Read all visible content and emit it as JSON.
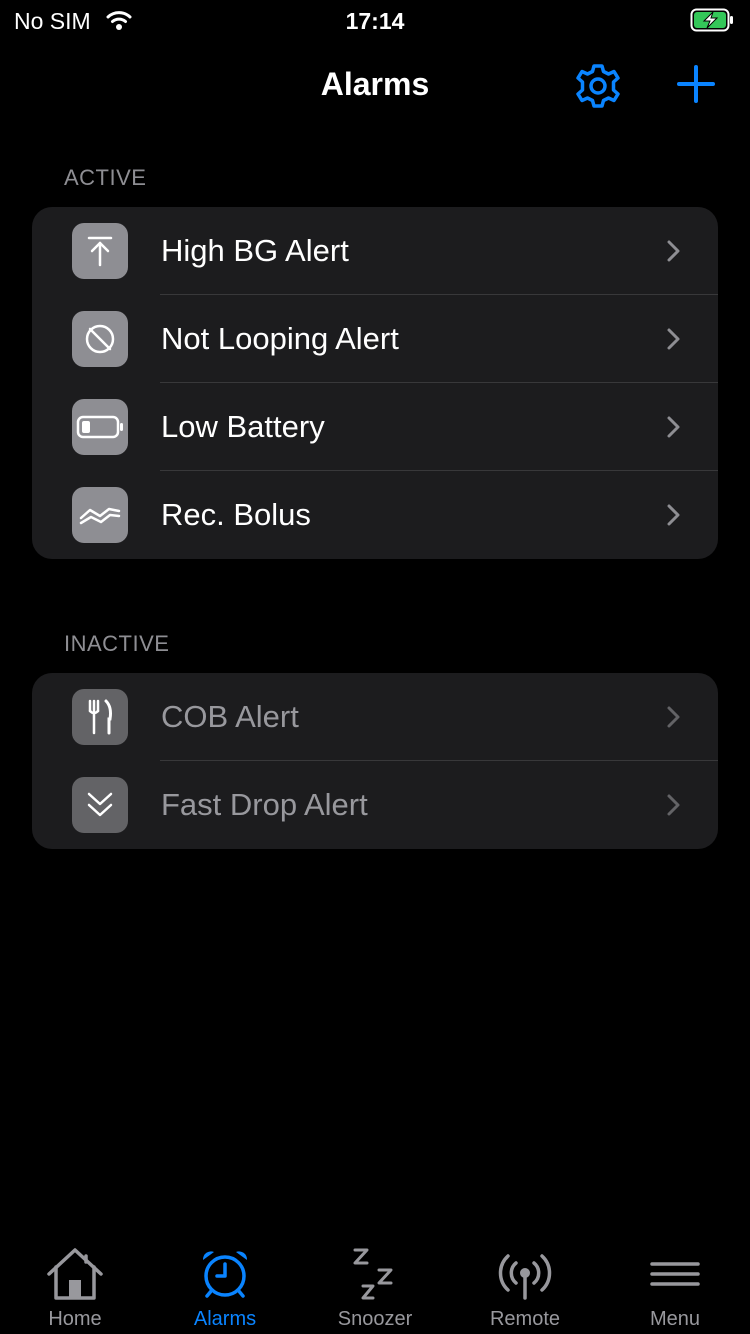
{
  "status_bar": {
    "carrier": "No SIM",
    "time": "17:14"
  },
  "nav": {
    "title": "Alarms",
    "settings_icon": "gear-icon",
    "add_icon": "plus-icon"
  },
  "sections": {
    "active": {
      "header": "ACTIVE",
      "items": [
        {
          "label": "High BG Alert",
          "icon": "arrow-up-to-line-icon"
        },
        {
          "label": "Not Looping Alert",
          "icon": "circle-slash-icon"
        },
        {
          "label": "Low Battery",
          "icon": "battery-low-icon"
        },
        {
          "label": "Rec. Bolus",
          "icon": "waveform-icon"
        }
      ]
    },
    "inactive": {
      "header": "INACTIVE",
      "items": [
        {
          "label": "COB Alert",
          "icon": "fork-knife-icon"
        },
        {
          "label": "Fast Drop Alert",
          "icon": "double-chevron-down-icon"
        }
      ]
    }
  },
  "tabs": [
    {
      "label": "Home",
      "icon": "house-icon",
      "active": false
    },
    {
      "label": "Alarms",
      "icon": "alarm-clock-icon",
      "active": true
    },
    {
      "label": "Snoozer",
      "icon": "zzz-icon",
      "active": false
    },
    {
      "label": "Remote",
      "icon": "antenna-icon",
      "active": false
    },
    {
      "label": "Menu",
      "icon": "menu-icon",
      "active": false
    }
  ],
  "colors": {
    "accent": "#0a84ff",
    "background": "#000000",
    "group_bg": "#1c1c1e",
    "secondary_text": "#8e8e93",
    "battery_green": "#34c759"
  }
}
